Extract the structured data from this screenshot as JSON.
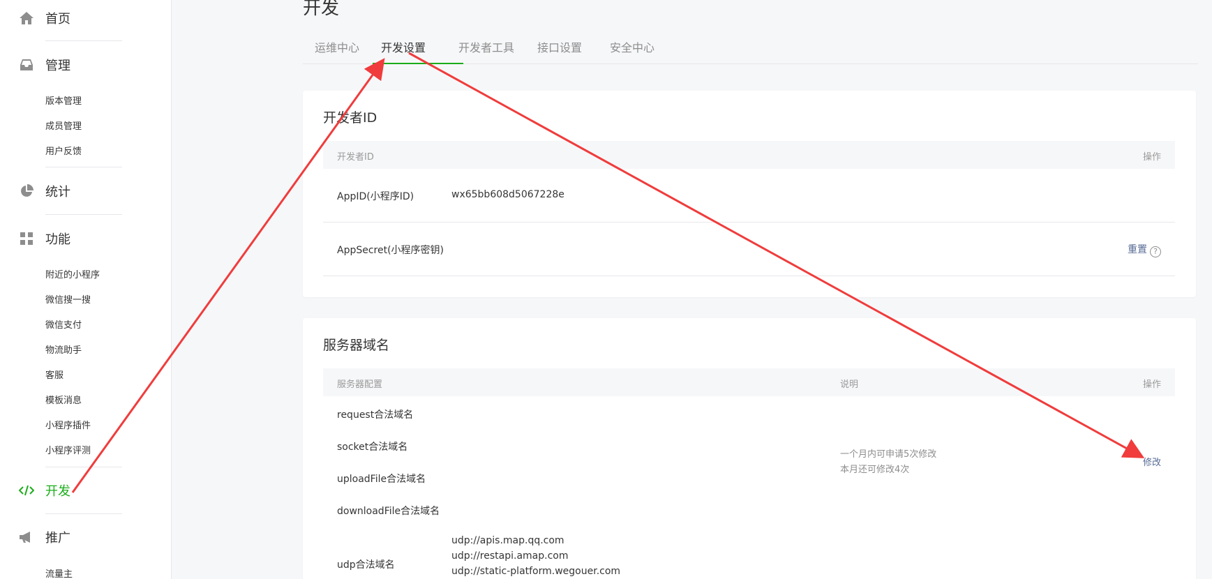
{
  "sidebar": {
    "home": {
      "label": "首页",
      "icon": "home-icon"
    },
    "manage": {
      "label": "管理",
      "icon": "inbox-icon",
      "items": [
        "版本管理",
        "成员管理",
        "用户反馈"
      ]
    },
    "stats": {
      "label": "统计",
      "icon": "pie-chart-icon"
    },
    "features": {
      "label": "功能",
      "icon": "grid-icon",
      "items": [
        "附近的小程序",
        "微信搜一搜",
        "微信支付",
        "物流助手",
        "客服",
        "模板消息",
        "小程序插件",
        "小程序评测"
      ]
    },
    "develop": {
      "label": "开发",
      "icon": "code-icon"
    },
    "promote": {
      "label": "推广",
      "icon": "megaphone-icon",
      "items": [
        "流量主"
      ]
    }
  },
  "page": {
    "title": "开发",
    "tabs": [
      "运维中心",
      "开发设置",
      "开发者工具",
      "接口设置",
      "安全中心"
    ],
    "active_tab": "开发设置"
  },
  "dev_id": {
    "title": "开发者ID",
    "col_name": "开发者ID",
    "col_action": "操作",
    "appid_label": "AppID(小程序ID)",
    "appid_value": "wx65bb608d5067228e",
    "secret_label": "AppSecret(小程序密钥)",
    "reset_label": "重置",
    "help_glyph": "?"
  },
  "server": {
    "title": "服务器域名",
    "col_config": "服务器配置",
    "col_desc": "说明",
    "col_action": "操作",
    "domains": [
      "request合法域名",
      "socket合法域名",
      "uploadFile合法域名",
      "downloadFile合法域名"
    ],
    "udp_label": "udp合法域名",
    "udp_values": [
      "udp://apis.map.qq.com",
      "udp://restapi.amap.com",
      "udp://static-platform.wegouer.com"
    ],
    "desc_line1": "一个月内可申请5次修改",
    "desc_line2": "本月还可修改4次",
    "modify_label": "修改"
  },
  "colors": {
    "accent": "#1aad19",
    "link": "#576b95",
    "annotation": "#f03c3c"
  }
}
